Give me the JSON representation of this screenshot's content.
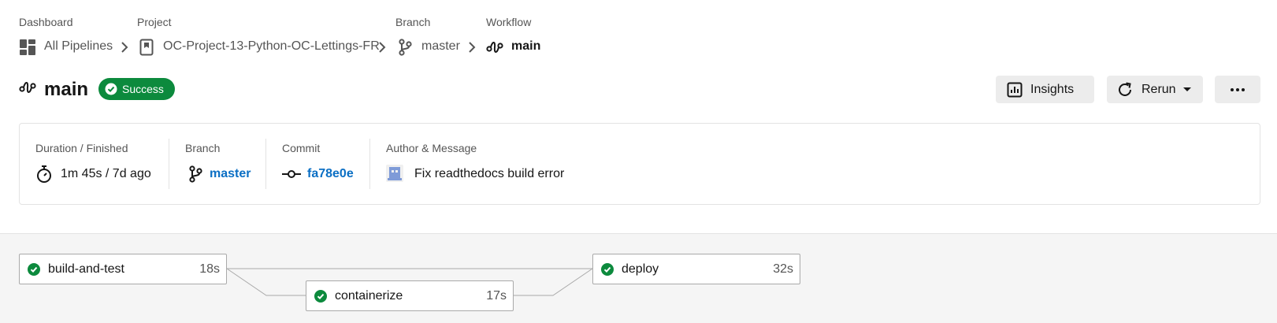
{
  "breadcrumb": {
    "dashboard": {
      "label": "Dashboard",
      "link": "All Pipelines"
    },
    "project": {
      "label": "Project",
      "link": "OC-Project-13-Python-OC-Lettings-FR"
    },
    "branch": {
      "label": "Branch",
      "link": "master"
    },
    "workflow": {
      "label": "Workflow",
      "current": "main"
    }
  },
  "header": {
    "title": "main",
    "status": "Success",
    "status_color": "#0c8a3d",
    "insights_label": "Insights",
    "rerun_label": "Rerun"
  },
  "summary": {
    "duration": {
      "label": "Duration / Finished",
      "value": "1m 45s / 7d ago"
    },
    "branch": {
      "label": "Branch",
      "value": "master"
    },
    "commit": {
      "label": "Commit",
      "value": "fa78e0e"
    },
    "author": {
      "label": "Author & Message",
      "message": "Fix readthedocs build error"
    }
  },
  "jobs": [
    {
      "name": "build-and-test",
      "duration": "18s",
      "status": "success"
    },
    {
      "name": "containerize",
      "duration": "17s",
      "status": "success"
    },
    {
      "name": "deploy",
      "duration": "32s",
      "status": "success"
    }
  ],
  "colors": {
    "success": "#0c8a3d",
    "link": "#0b6fc4"
  },
  "icons": [
    "dashboard-icon",
    "chevron-right-icon",
    "project-icon",
    "branch-icon",
    "workflow-icon",
    "check-circle-icon",
    "insights-icon",
    "rerun-icon",
    "caret-down-icon",
    "more-icon",
    "stopwatch-icon",
    "commit-icon",
    "avatar"
  ]
}
